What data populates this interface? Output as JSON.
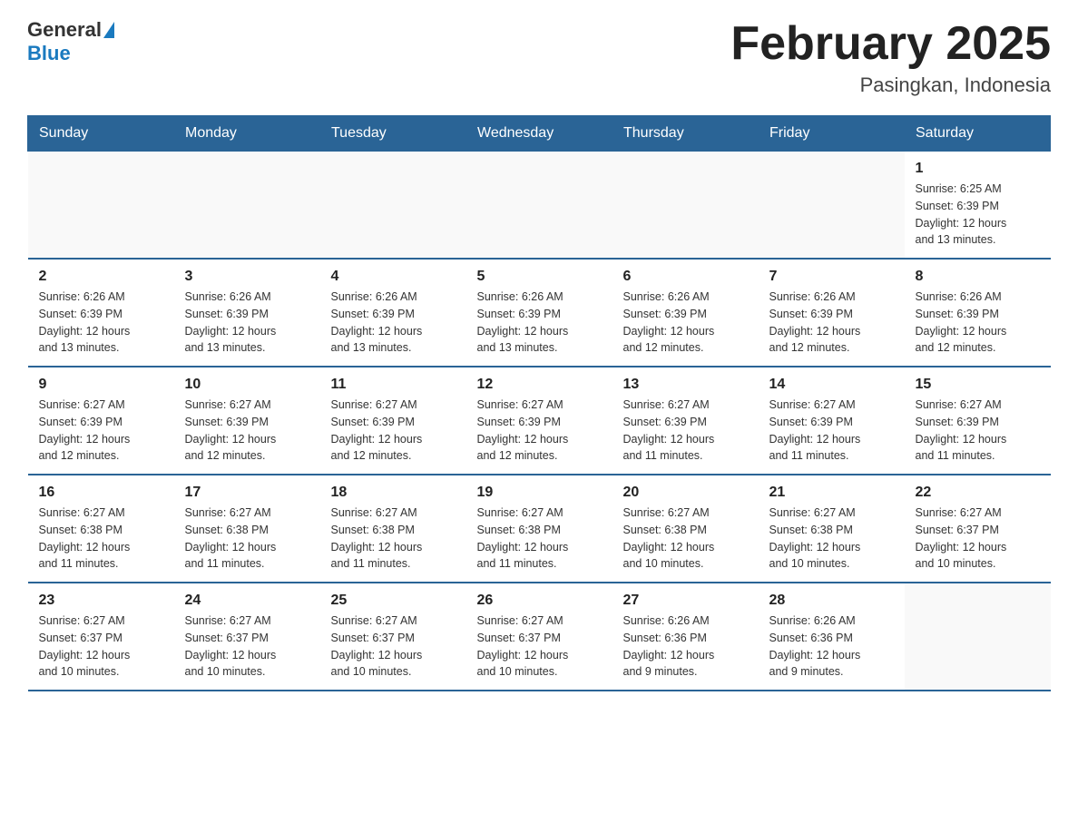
{
  "header": {
    "logo_general": "General",
    "logo_blue": "Blue",
    "title": "February 2025",
    "subtitle": "Pasingkan, Indonesia"
  },
  "weekdays": [
    "Sunday",
    "Monday",
    "Tuesday",
    "Wednesday",
    "Thursday",
    "Friday",
    "Saturday"
  ],
  "rows": [
    [
      {
        "day": "",
        "info": ""
      },
      {
        "day": "",
        "info": ""
      },
      {
        "day": "",
        "info": ""
      },
      {
        "day": "",
        "info": ""
      },
      {
        "day": "",
        "info": ""
      },
      {
        "day": "",
        "info": ""
      },
      {
        "day": "1",
        "info": "Sunrise: 6:25 AM\nSunset: 6:39 PM\nDaylight: 12 hours\nand 13 minutes."
      }
    ],
    [
      {
        "day": "2",
        "info": "Sunrise: 6:26 AM\nSunset: 6:39 PM\nDaylight: 12 hours\nand 13 minutes."
      },
      {
        "day": "3",
        "info": "Sunrise: 6:26 AM\nSunset: 6:39 PM\nDaylight: 12 hours\nand 13 minutes."
      },
      {
        "day": "4",
        "info": "Sunrise: 6:26 AM\nSunset: 6:39 PM\nDaylight: 12 hours\nand 13 minutes."
      },
      {
        "day": "5",
        "info": "Sunrise: 6:26 AM\nSunset: 6:39 PM\nDaylight: 12 hours\nand 13 minutes."
      },
      {
        "day": "6",
        "info": "Sunrise: 6:26 AM\nSunset: 6:39 PM\nDaylight: 12 hours\nand 12 minutes."
      },
      {
        "day": "7",
        "info": "Sunrise: 6:26 AM\nSunset: 6:39 PM\nDaylight: 12 hours\nand 12 minutes."
      },
      {
        "day": "8",
        "info": "Sunrise: 6:26 AM\nSunset: 6:39 PM\nDaylight: 12 hours\nand 12 minutes."
      }
    ],
    [
      {
        "day": "9",
        "info": "Sunrise: 6:27 AM\nSunset: 6:39 PM\nDaylight: 12 hours\nand 12 minutes."
      },
      {
        "day": "10",
        "info": "Sunrise: 6:27 AM\nSunset: 6:39 PM\nDaylight: 12 hours\nand 12 minutes."
      },
      {
        "day": "11",
        "info": "Sunrise: 6:27 AM\nSunset: 6:39 PM\nDaylight: 12 hours\nand 12 minutes."
      },
      {
        "day": "12",
        "info": "Sunrise: 6:27 AM\nSunset: 6:39 PM\nDaylight: 12 hours\nand 12 minutes."
      },
      {
        "day": "13",
        "info": "Sunrise: 6:27 AM\nSunset: 6:39 PM\nDaylight: 12 hours\nand 11 minutes."
      },
      {
        "day": "14",
        "info": "Sunrise: 6:27 AM\nSunset: 6:39 PM\nDaylight: 12 hours\nand 11 minutes."
      },
      {
        "day": "15",
        "info": "Sunrise: 6:27 AM\nSunset: 6:39 PM\nDaylight: 12 hours\nand 11 minutes."
      }
    ],
    [
      {
        "day": "16",
        "info": "Sunrise: 6:27 AM\nSunset: 6:38 PM\nDaylight: 12 hours\nand 11 minutes."
      },
      {
        "day": "17",
        "info": "Sunrise: 6:27 AM\nSunset: 6:38 PM\nDaylight: 12 hours\nand 11 minutes."
      },
      {
        "day": "18",
        "info": "Sunrise: 6:27 AM\nSunset: 6:38 PM\nDaylight: 12 hours\nand 11 minutes."
      },
      {
        "day": "19",
        "info": "Sunrise: 6:27 AM\nSunset: 6:38 PM\nDaylight: 12 hours\nand 11 minutes."
      },
      {
        "day": "20",
        "info": "Sunrise: 6:27 AM\nSunset: 6:38 PM\nDaylight: 12 hours\nand 10 minutes."
      },
      {
        "day": "21",
        "info": "Sunrise: 6:27 AM\nSunset: 6:38 PM\nDaylight: 12 hours\nand 10 minutes."
      },
      {
        "day": "22",
        "info": "Sunrise: 6:27 AM\nSunset: 6:37 PM\nDaylight: 12 hours\nand 10 minutes."
      }
    ],
    [
      {
        "day": "23",
        "info": "Sunrise: 6:27 AM\nSunset: 6:37 PM\nDaylight: 12 hours\nand 10 minutes."
      },
      {
        "day": "24",
        "info": "Sunrise: 6:27 AM\nSunset: 6:37 PM\nDaylight: 12 hours\nand 10 minutes."
      },
      {
        "day": "25",
        "info": "Sunrise: 6:27 AM\nSunset: 6:37 PM\nDaylight: 12 hours\nand 10 minutes."
      },
      {
        "day": "26",
        "info": "Sunrise: 6:27 AM\nSunset: 6:37 PM\nDaylight: 12 hours\nand 10 minutes."
      },
      {
        "day": "27",
        "info": "Sunrise: 6:26 AM\nSunset: 6:36 PM\nDaylight: 12 hours\nand 9 minutes."
      },
      {
        "day": "28",
        "info": "Sunrise: 6:26 AM\nSunset: 6:36 PM\nDaylight: 12 hours\nand 9 minutes."
      },
      {
        "day": "",
        "info": ""
      }
    ]
  ]
}
